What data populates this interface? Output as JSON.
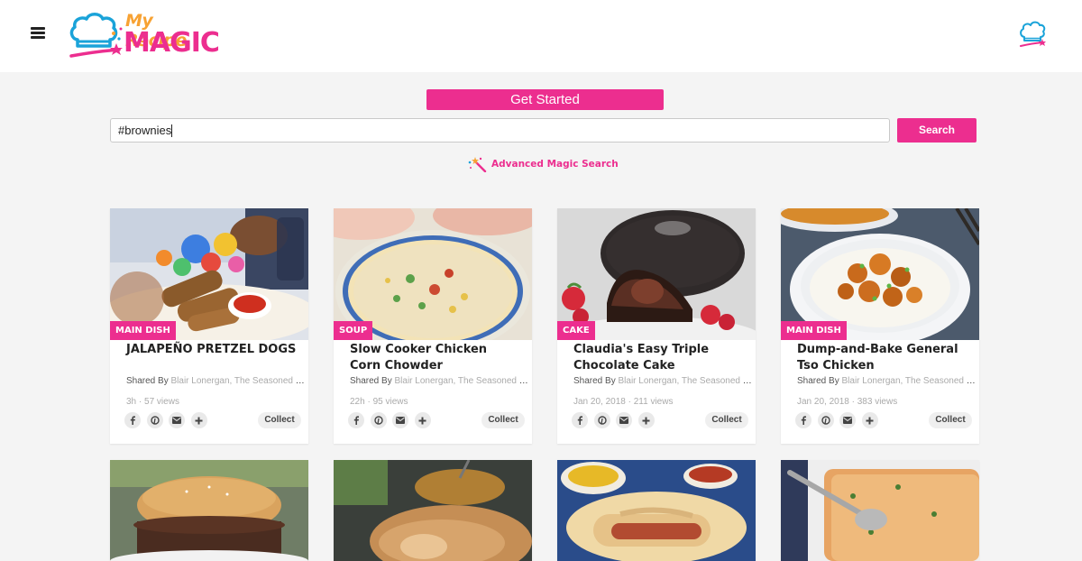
{
  "brand": {
    "top": "My Recipe",
    "bottom": "MAGIC"
  },
  "get_started": "Get Started",
  "search": {
    "value": "#brownies",
    "button": "Search",
    "advanced": "Advanced Magic Search"
  },
  "cards": [
    {
      "tag": "MAIN DISH",
      "title": "JALAPEÑO PRETZEL DOGS",
      "shared_label": "Shared By",
      "shared_by": "Blair Lonergan, The Seasoned Mom",
      "date": "3h",
      "views": "57 views",
      "collect": "Collect"
    },
    {
      "tag": "SOUP",
      "title": "Slow Cooker Chicken Corn Chowder",
      "shared_label": "Shared By",
      "shared_by": "Blair Lonergan, The Seasoned Mom",
      "date": "22h",
      "views": "95 views",
      "collect": "Collect"
    },
    {
      "tag": "CAKE",
      "title": "Claudia's Easy Triple Chocolate Cake",
      "shared_label": "Shared By",
      "shared_by": "Blair Lonergan, The Seasoned Mom",
      "date": "Jan 20, 2018",
      "views": "211 views",
      "collect": "Collect"
    },
    {
      "tag": "MAIN DISH",
      "title": "Dump-and-Bake General Tso Chicken",
      "shared_label": "Shared By",
      "shared_by": "Blair Lonergan, The Seasoned Mom",
      "date": "Jan 20, 2018",
      "views": "383 views",
      "collect": "Collect"
    }
  ],
  "meta_separator": "·",
  "icons": [
    "menu-icon",
    "chef-hat-icon",
    "magic-wand-icon",
    "facebook-icon",
    "pinterest-icon",
    "email-icon",
    "plus-icon"
  ],
  "colors": {
    "accent": "#ec2e8f",
    "logo_orange": "#f7a233",
    "logo_blue": "#1aa3d9"
  }
}
